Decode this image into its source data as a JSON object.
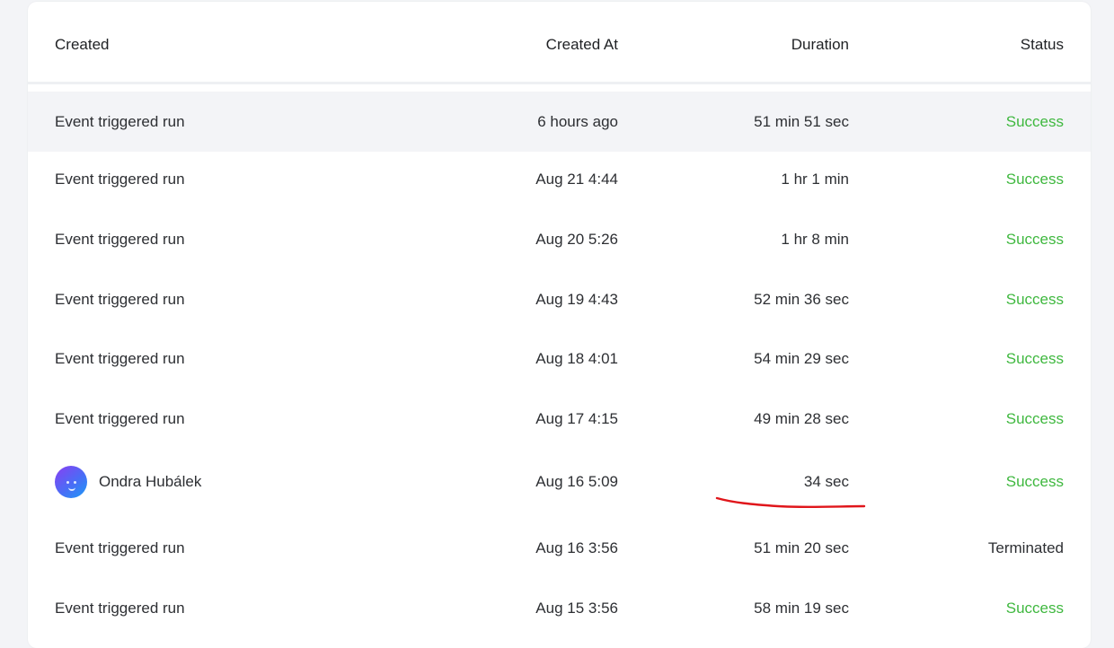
{
  "table": {
    "headers": {
      "created": "Created",
      "created_at": "Created At",
      "duration": "Duration",
      "status": "Status"
    },
    "rows": [
      {
        "created": "Event triggered run",
        "created_at": "6 hours ago",
        "duration": "51 min 51 sec",
        "status": "Success"
      },
      {
        "created": "Event triggered run",
        "created_at": "Aug 21 4:44",
        "duration": "1 hr 1 min",
        "status": "Success"
      },
      {
        "created": "Event triggered run",
        "created_at": "Aug 20 5:26",
        "duration": "1 hr 8 min",
        "status": "Success"
      },
      {
        "created": "Event triggered run",
        "created_at": "Aug 19 4:43",
        "duration": "52 min 36 sec",
        "status": "Success"
      },
      {
        "created": "Event triggered run",
        "created_at": "Aug 18 4:01",
        "duration": "54 min 29 sec",
        "status": "Success"
      },
      {
        "created": "Event triggered run",
        "created_at": "Aug 17 4:15",
        "duration": "49 min 28 sec",
        "status": "Success"
      },
      {
        "created": "Ondra Hubálek",
        "created_at": "Aug 16 5:09",
        "duration": "34 sec",
        "status": "Success"
      },
      {
        "created": "Event triggered run",
        "created_at": "Aug 16 3:56",
        "duration": "51 min 20 sec",
        "status": "Terminated"
      },
      {
        "created": "Event triggered run",
        "created_at": "Aug 15 3:56",
        "duration": "58 min 19 sec",
        "status": "Success"
      }
    ]
  },
  "colors": {
    "success": "#3fb83f",
    "annotation": "#e0161b",
    "highlight_row": "#f3f4f7"
  },
  "icons": {
    "avatar": "user-avatar-icon"
  }
}
